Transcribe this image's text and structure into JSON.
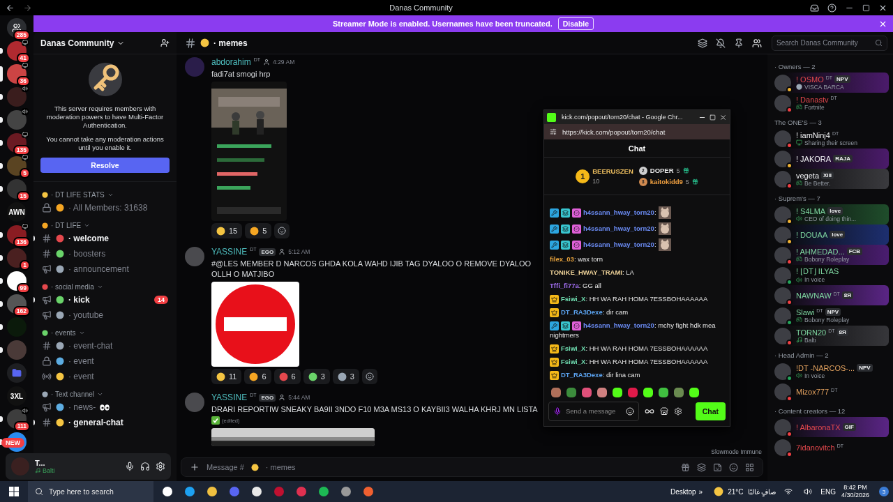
{
  "window": {
    "title": "Danas Community"
  },
  "banner": {
    "text": "Streamer Mode is enabled. Usernames have been truncated.",
    "button": "Disable"
  },
  "servers": [
    {
      "kind": "home",
      "badge": "285",
      "unread": false,
      "selected": false
    },
    {
      "kind": "server",
      "badge": "41",
      "indicator": {
        "kind": "screen"
      },
      "unread": true,
      "selected": false
    },
    {
      "kind": "server",
      "badge": "36",
      "indicator": {
        "kind": "screen"
      },
      "unread": false,
      "selected": true
    },
    {
      "kind": "server",
      "indicator": {
        "kind": "voice"
      },
      "unread": true,
      "selected": false
    },
    {
      "kind": "server",
      "indicator": {
        "kind": "voice"
      },
      "unread": true,
      "selected": false
    },
    {
      "kind": "server",
      "badge": "135",
      "indicator": {
        "kind": "screen"
      },
      "unread": true,
      "selected": false
    },
    {
      "kind": "server",
      "badge": "5",
      "indicator": {
        "kind": "screen"
      },
      "unread": true,
      "selected": false
    },
    {
      "kind": "server",
      "badge": "15",
      "unread": true,
      "selected": false
    },
    {
      "kind": "text",
      "label": "AWN",
      "unread": false,
      "selected": false
    },
    {
      "kind": "server",
      "badge": "136",
      "indicator": {
        "kind": "screen"
      },
      "unread": true,
      "selected": false
    },
    {
      "kind": "server",
      "badge": "1",
      "unread": true,
      "selected": false
    },
    {
      "kind": "server",
      "badge": "99",
      "unread": true,
      "selected": false
    },
    {
      "kind": "server",
      "badge": "162",
      "unread": true,
      "selected": false
    },
    {
      "kind": "server",
      "unread": true,
      "selected": false
    },
    {
      "kind": "server",
      "unread": true,
      "selected": false
    },
    {
      "kind": "folder",
      "unread": false,
      "selected": false
    },
    {
      "kind": "text",
      "label": "3XL",
      "unread": false,
      "selected": false
    },
    {
      "kind": "server",
      "badge": "111",
      "indicator": {
        "kind": "voice"
      },
      "unread": true,
      "selected": false
    },
    {
      "kind": "server",
      "unread": true,
      "selected": false
    }
  ],
  "new_badge": "NEW",
  "server_header": {
    "name": "Danas Community"
  },
  "mfa_notice": {
    "text": "This server requires members with moderation powers to have Multi-Factor Authentication.",
    "note": "You cannot take any moderation actions until you enable it.",
    "button": "Resolve"
  },
  "categories": [
    {
      "name": "· DT LIFE STATS",
      "channels": [
        {
          "kind": "locked",
          "name": "· All Members: 31638",
          "unread": false
        }
      ]
    },
    {
      "name": "· DT LIFE",
      "channels": [
        {
          "kind": "text",
          "name": "· welcome",
          "unread": true
        },
        {
          "kind": "text",
          "name": "· boosters",
          "unread": false
        },
        {
          "kind": "announce",
          "name": "· announcement",
          "unread": false
        }
      ]
    },
    {
      "name": "· social media",
      "channels": [
        {
          "kind": "announce",
          "name": "· kick",
          "unread": true,
          "badge": "14"
        },
        {
          "kind": "announce",
          "name": "· youtube",
          "unread": false
        }
      ]
    },
    {
      "name": "· events",
      "channels": [
        {
          "kind": "text",
          "name": "· event-chat",
          "unread": false
        },
        {
          "kind": "locked",
          "name": "· event",
          "unread": false
        },
        {
          "kind": "stage",
          "name": "· event",
          "unread": false
        }
      ]
    },
    {
      "name": "· Text channel",
      "channels": [
        {
          "kind": "announce",
          "name": "· news-",
          "unread": false
        },
        {
          "kind": "text",
          "name": "· general-chat",
          "unread": true
        }
      ]
    }
  ],
  "user_panel": {
    "name": "T...",
    "activity": "Balti"
  },
  "channel_header": {
    "name": "· memes",
    "search": {
      "placeholder": "Search Danas Community"
    }
  },
  "messages": [
    {
      "author": "abdorahim",
      "tag": "DT",
      "time": "4:29 AM",
      "text": "fadi7at smogi hrp",
      "attachment": {
        "kind": "picture"
      },
      "reactions": [
        {
          "count": "15"
        },
        {
          "count": "5"
        }
      ]
    },
    {
      "author": "YASSINE",
      "tag": "DT",
      "badge": "EGO",
      "time": "5:12 AM",
      "text": "#@LES MEMBER D NARCOS GHDA KOLA WAHD IJIB TAG DYALOO O REMOVE DYALOO OLLH O MATJIBO",
      "attachment": {
        "kind": "no-entry-sign"
      },
      "reactions": [
        {
          "count": "11"
        },
        {
          "count": "6"
        },
        {
          "count": "6"
        },
        {
          "count": "3"
        },
        {
          "count": "3"
        }
      ]
    },
    {
      "author": "YASSINE",
      "tag": "DT",
      "badge": "EGO",
      "time": "5:44 AM",
      "text": "DRARI REPORTIW SNEAKY BA9II 3NDO F10 M3A MS13 O KAYBII3 WALHA KHRJ MN LISTA",
      "edited": "(edited)",
      "attachment": {
        "kind": "picture"
      }
    }
  ],
  "slowmode": "Slowmode Immune",
  "composer": {
    "prefix": "Message #",
    "channel": "· memes"
  },
  "member_groups": [
    {
      "title": "· Owners — 2",
      "color": "#e5484d",
      "members": [
        {
          "name": "! OSMO",
          "tag": "DT",
          "badge": "NPV",
          "activity": {
            "kind": "custom",
            "text": "VISCA BARCA"
          },
          "presence": {
            "color": "#f0b232"
          },
          "nameplate": {
            "color": "#4b1b6b"
          }
        },
        {
          "name": "! Danastv",
          "tag": "DT",
          "activity": {
            "kind": "game",
            "text": "Fortnite"
          },
          "presence": {
            "color": "#f23f43"
          }
        }
      ]
    },
    {
      "title": "The ONE'S — 3",
      "color": "#f2f3f5",
      "members": [
        {
          "name": "! iamNinj4",
          "tag": "DT",
          "activity": {
            "kind": "screen",
            "text": "Sharing their screen"
          },
          "presence": {
            "color": "#f23f43"
          }
        },
        {
          "name": "! JAKORA",
          "badge": "RAJA",
          "presence": {
            "color": "#f0b232"
          },
          "nameplate": {
            "color": "#4b1b6b"
          }
        },
        {
          "name": "vegeta",
          "badge": "XIII",
          "activity": {
            "kind": "game",
            "text": "Be Better."
          },
          "presence": {
            "color": "#f23f43"
          },
          "nameplate": {
            "color": "#3a3a3e"
          }
        }
      ]
    },
    {
      "title": "· Suprem's — 7",
      "color": "#7ed6a0",
      "members": [
        {
          "name": "! S4LMA",
          "badge": "love",
          "activity": {
            "kind": "voice",
            "text": "CEO of doing thin..."
          },
          "presence": {
            "color": "#f0b232"
          },
          "nameplate": {
            "color": "#1f4d2b"
          }
        },
        {
          "name": "! DOUAA",
          "badge": "love",
          "presence": {
            "color": "#f0b232"
          },
          "nameplate": {
            "color": "#1d2f70"
          }
        },
        {
          "name": "! AHMEDAD...",
          "badge": "FCB",
          "activity": {
            "kind": "game",
            "text": "Bobony Roleplay"
          },
          "presence": {
            "color": "#f23f43"
          },
          "nameplate": {
            "color": "#4a1d70"
          }
        },
        {
          "name": "! ⌊DT⌋ ILYAS",
          "activity": {
            "kind": "voice",
            "text": "In voice"
          },
          "presence": {
            "color": "#23a55a"
          }
        },
        {
          "name": "NAWNAW",
          "tag": "DT",
          "badge": "8Я",
          "presence": {
            "color": "#f23f43"
          },
          "nameplate": {
            "color": "#5a2585"
          }
        },
        {
          "name": "Slawi",
          "tag": "DT",
          "badge": "NPV",
          "activity": {
            "kind": "game",
            "text": "Bobony Roleplay"
          },
          "presence": {
            "color": "#23a55a"
          }
        },
        {
          "name": "TORN20",
          "tag": "DT",
          "badge": "8Я",
          "activity": {
            "kind": "music",
            "text": "Balti"
          },
          "presence": {
            "color": "#f23f43"
          },
          "nameplate": {
            "color": "#36363a"
          }
        }
      ]
    },
    {
      "title": "· Head Admin — 2",
      "color": "#e3a25f",
      "members": [
        {
          "name": "!DT -NARCOS-...",
          "badge": "NPV",
          "activity": {
            "kind": "voice",
            "text": "In voice"
          },
          "presence": {
            "color": "#23a55a"
          }
        },
        {
          "name": "Mizox777",
          "tag": "DT",
          "presence": {
            "color": "#f23f43"
          }
        }
      ]
    },
    {
      "title": "· Content creators — 12",
      "color": "#e5484d",
      "members": [
        {
          "name": "! AlbaronaTX",
          "badge": "GIF",
          "presence": {
            "color": "#f23f43"
          },
          "nameplate": {
            "color": "#5a2585"
          }
        },
        {
          "name": "7idanovitch",
          "tag": "DT",
          "presence": {
            "color": "#f23f43"
          }
        }
      ]
    }
  ],
  "kick_popup": {
    "title": "kick.com/popout/torn20/chat - Google Chr...",
    "url": "https://kick.com/popout/torn20/chat",
    "heading": "Chat",
    "leaderboard": [
      {
        "rank": "1",
        "name": "BEERUSZEN",
        "count": "10"
      },
      {
        "rank": "2",
        "name": "DOPER",
        "count": "5"
      },
      {
        "rank": "3",
        "name": "kaitokidd9",
        "count": "5"
      }
    ],
    "messages": [
      {
        "kind": "mod",
        "user": "h4ssann_hway_torn20",
        "color": "#6b8cf5",
        "text": ":",
        "emote": true
      },
      {
        "kind": "mod",
        "user": "h4ssann_hway_torn20",
        "color": "#6b8cf5",
        "text": ":",
        "emote": true
      },
      {
        "kind": "mod",
        "user": "h4ssann_hway_torn20",
        "color": "#6b8cf5",
        "text": ":",
        "emote": true
      },
      {
        "kind": "plain",
        "user": "filex_03",
        "color": "#e8a33d",
        "text": ": wax torn"
      },
      {
        "kind": "plain",
        "user": "TONIKE_HWAY_TRAMI",
        "color": "#f0d49a",
        "text": ": LA"
      },
      {
        "kind": "plain",
        "user": "Tffi_fi77a",
        "color": "#a26ff2",
        "text": ": GG all"
      },
      {
        "kind": "vip",
        "user": "Fsiwi_X",
        "color": "#72e3b5",
        "text": ": HH WA RAH HOMA 7ESSBOHAAAAAA"
      },
      {
        "kind": "vip",
        "user": "DT_RA3Dexe",
        "color": "#5ba3f0",
        "text": ": dir cam"
      },
      {
        "kind": "mod",
        "user": "h4ssann_hway_torn20",
        "color": "#6b8cf5",
        "text": ": mchy fight hdk mea nightmers"
      },
      {
        "kind": "vip",
        "user": "Fsiwi_X",
        "color": "#72e3b5",
        "text": ": HH WA RAH HOMA 7ESSBOHAAAAAA"
      },
      {
        "kind": "vip",
        "user": "Fsiwi_X",
        "color": "#72e3b5",
        "text": ": HH WA RAH HOMA 7ESSBOHAAAAAA"
      },
      {
        "kind": "vip",
        "user": "DT_RA3Dexe",
        "color": "#5ba3f0",
        "text": ": dir lina cam"
      }
    ],
    "input": {
      "placeholder": "Send a message"
    },
    "button": "Chat"
  },
  "taskbar": {
    "search": "Type here to search",
    "desktop": "Desktop",
    "chevron": "»",
    "temperature": "21°C",
    "weather": "صافٍ غالبًا",
    "language": "ENG",
    "time": "8:42 PM",
    "date": "4/30/2026",
    "notifications": "3"
  }
}
